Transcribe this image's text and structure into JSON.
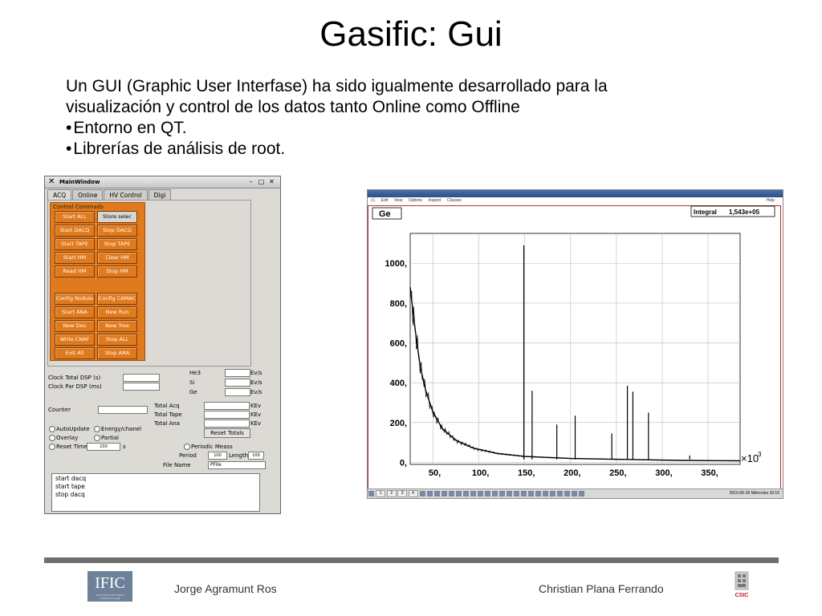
{
  "slide": {
    "title": "Gasific: Gui",
    "intro_line1": "Un GUI (Graphic User Interfase) ha sido igualmente desarrollado para la",
    "intro_line2": "visualización y control de los datos tanto Online como Offline",
    "bullets": [
      "Entorno en QT.",
      "Librerías de análisis de root."
    ],
    "bullet2_tail": "."
  },
  "qt_window": {
    "title": "MainWindow",
    "tabs": [
      "ACQ",
      "Online",
      "HV Control",
      "Digi"
    ],
    "group_label": "Control Commads",
    "buttons": [
      "Start ALL",
      "Store selec",
      "Start DACQ",
      "Stop DACQ",
      "Start TAPE",
      "Stop TAPE",
      "Start HM",
      "Clear HM",
      "Read HM",
      "Stop HM",
      "Config Nodule",
      "Config CAMAC",
      "Start ANA",
      "New Run",
      "New Dev",
      "New Tree",
      "Write CNAF",
      "Stop ALL",
      "Exit All",
      "Stop ANA"
    ],
    "labels": {
      "clock_total": "Clock Total DSP (s)",
      "clock_par": "Clock Par DSP (ms)",
      "counter": "Counter",
      "he3": "He3",
      "si": "Si",
      "ge": "Ge",
      "evs1": "Ev/s",
      "evs2": "Ev/s",
      "evs3": "Ev/s",
      "total_acq": "Total Acq",
      "total_tape": "Total Tape",
      "total_ana": "Total Ana",
      "kev1": "KEv",
      "kev2": "KEv",
      "kev3": "KEv",
      "reset_totals": "Reset Totals",
      "auto_update": "AutoUpdate",
      "energy_chanel": "Energy/chanel",
      "overlay": "Overlay",
      "partial": "Partial",
      "reset_time": "Reset Time",
      "s_unit": "s",
      "reset_time_value": "100",
      "periodic": "Periodic Meass",
      "period": "Period",
      "period_value": "100",
      "length": "Length",
      "length_value": "100",
      "file_name": "File Name",
      "file_value": "PFile"
    },
    "console_lines": [
      "start dacq",
      "start tape",
      "stop dacq"
    ]
  },
  "root_window": {
    "menu": [
      "c1",
      "Edit",
      "View",
      "Options",
      "Inspect",
      "Classes",
      "Help"
    ],
    "histogram_name": "Ge",
    "integral_label": "Integral",
    "integral_value": "1,543e+05",
    "x_multiplier": "×10",
    "x_multiplier_exp": "3",
    "taskbar_clock": "2010-05-26  Miércoles  16:16",
    "taskbar_pages": [
      "1",
      "2",
      "3",
      "4"
    ]
  },
  "chart_data": {
    "type": "line",
    "title": "",
    "xlabel": "",
    "ylabel": "",
    "xlim": [
      25,
      385
    ],
    "ylim": [
      -10,
      1150
    ],
    "x_ticks": [
      50,
      100,
      150,
      200,
      250,
      300,
      350
    ],
    "x_tick_labels": [
      "50,",
      "100,",
      "150,",
      "200,",
      "250,",
      "300,",
      "350,"
    ],
    "y_ticks": [
      0,
      200,
      400,
      600,
      800,
      1000
    ],
    "y_tick_labels": [
      "0,",
      "200,",
      "400,",
      "600,",
      "800,",
      "1000,"
    ],
    "grid": true,
    "baseline_decay": [
      [
        25,
        880
      ],
      [
        28,
        760
      ],
      [
        32,
        610
      ],
      [
        36,
        480
      ],
      [
        42,
        360
      ],
      [
        50,
        250
      ],
      [
        60,
        170
      ],
      [
        75,
        110
      ],
      [
        95,
        70
      ],
      [
        120,
        45
      ],
      [
        150,
        30
      ],
      [
        200,
        20
      ],
      [
        260,
        15
      ],
      [
        320,
        10
      ],
      [
        385,
        8
      ]
    ],
    "peaks": [
      {
        "x": 149,
        "y": 1090
      },
      {
        "x": 158,
        "y": 360
      },
      {
        "x": 185,
        "y": 190
      },
      {
        "x": 205,
        "y": 235
      },
      {
        "x": 245,
        "y": 145
      },
      {
        "x": 262,
        "y": 385
      },
      {
        "x": 268,
        "y": 355
      },
      {
        "x": 285,
        "y": 250
      },
      {
        "x": 330,
        "y": 35
      }
    ]
  },
  "footer": {
    "author_left": "Jorge Agramunt Ros",
    "author_right": "Christian Plana Ferrando",
    "logo_left": "IFIC",
    "logo_left_sub": "INSTITUTO DE FISICA CORPUSCULAR",
    "logo_right": "CSIC"
  },
  "colors": {
    "accent_orange": "#e07a1e",
    "footer_rule": "#6e6e6e",
    "plot_frame": "#b03030"
  }
}
